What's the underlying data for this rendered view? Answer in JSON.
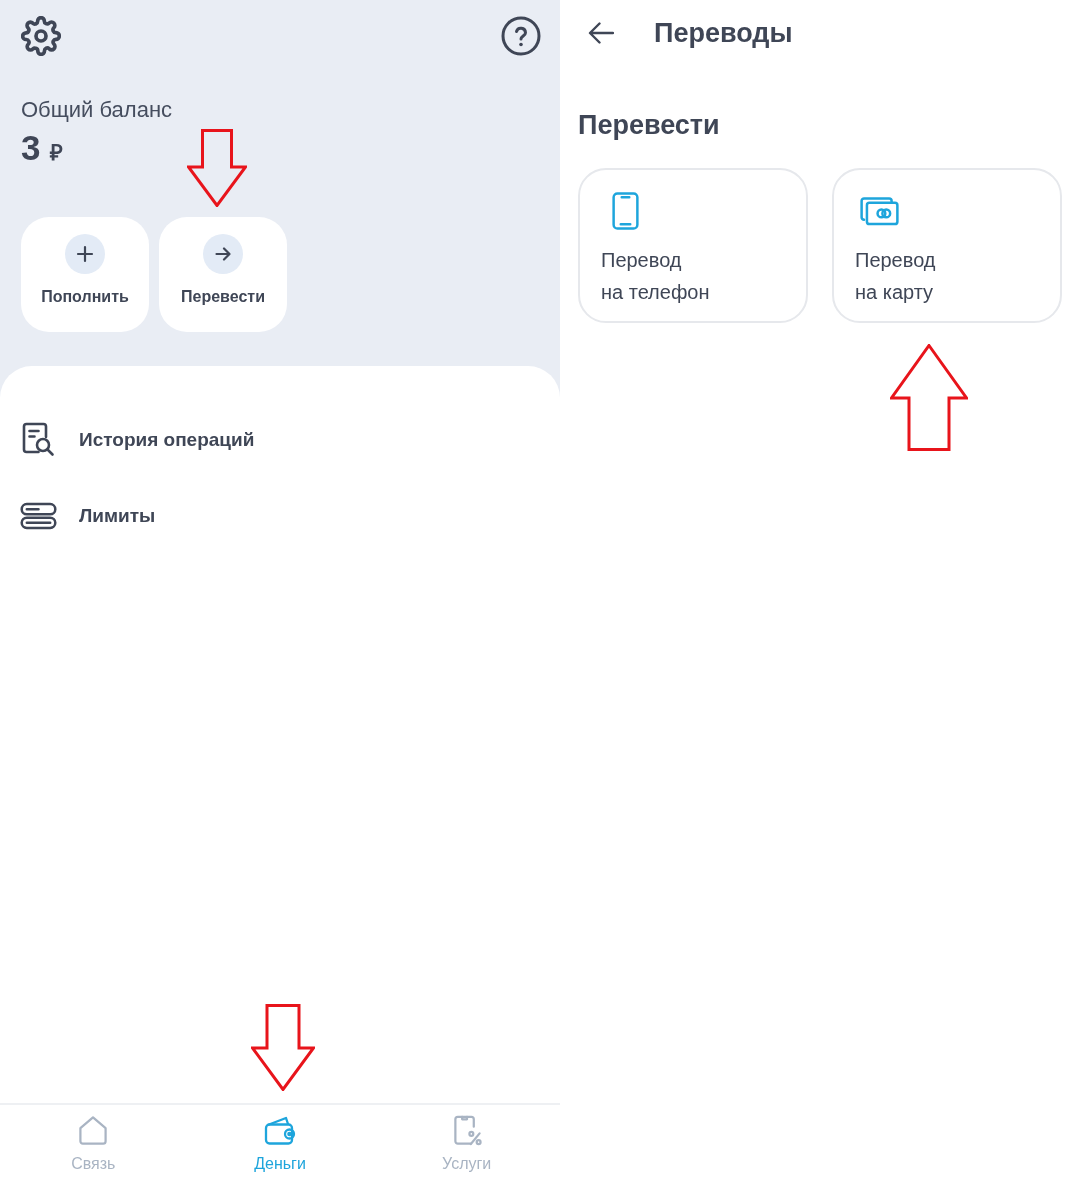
{
  "left_screen": {
    "balance": {
      "label": "Общий баланс",
      "amount": "3",
      "currency": "₽"
    },
    "actions": [
      {
        "kind": "top_up",
        "label": "Пополнить",
        "marked_by_arrow": false
      },
      {
        "kind": "transfer",
        "label": "Перевести",
        "marked_by_arrow": true
      }
    ],
    "menu": [
      {
        "kind": "history",
        "label": "История операций"
      },
      {
        "kind": "limits",
        "label": "Лимиты"
      }
    ],
    "bottom_nav": [
      {
        "kind": "home",
        "label": "Связь",
        "selected": false,
        "marked_by_arrow": false
      },
      {
        "kind": "wallet",
        "label": "Деньги",
        "selected": true,
        "marked_by_arrow": true
      },
      {
        "kind": "services",
        "label": "Услуги",
        "selected": false,
        "marked_by_arrow": false
      }
    ]
  },
  "right_screen": {
    "title": "Переводы",
    "section_title": "Перевести",
    "options": [
      {
        "kind": "phone",
        "label": "Перевод\nна телефон",
        "marked_by_arrow": false
      },
      {
        "kind": "card",
        "label": "Перевод\nна карту",
        "marked_by_arrow": true
      }
    ]
  }
}
